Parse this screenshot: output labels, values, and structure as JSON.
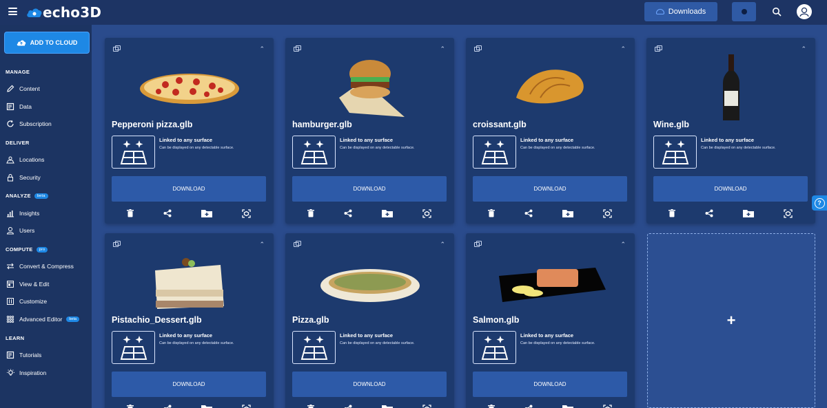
{
  "app": {
    "name": "echo3D"
  },
  "topbar": {
    "downloads_label": "Downloads"
  },
  "sidebar": {
    "add_button": "ADD TO CLOUD",
    "sections": {
      "manage": "MANAGE",
      "deliver": "DELIVER",
      "analyze": "ANALYZE",
      "analyze_badge": "beta",
      "compute": "COMPUTE",
      "compute_badge": "pro",
      "learn": "LEARN"
    },
    "items": {
      "content": "Content",
      "data": "Data",
      "subscription": "Subscription",
      "locations": "Locations",
      "security": "Security",
      "insights": "Insights",
      "users": "Users",
      "convert": "Convert & Compress",
      "view_edit": "View & Edit",
      "customize": "Customize",
      "advanced_editor": "Advanced Editor",
      "advanced_badge": "beta",
      "tutorials": "Tutorials",
      "inspiration": "Inspiration"
    }
  },
  "cards": [
    {
      "title": "Pepperoni pizza.glb",
      "thumb": "pepperoni-pizza"
    },
    {
      "title": "hamburger.glb",
      "thumb": "hamburger"
    },
    {
      "title": "croissant.glb",
      "thumb": "croissant"
    },
    {
      "title": "Wine.glb",
      "thumb": "wine-bottle"
    },
    {
      "title": "Pistachio_Dessert.glb",
      "thumb": "pistachio-dessert"
    },
    {
      "title": "Pizza.glb",
      "thumb": "pizza"
    },
    {
      "title": "Salmon.glb",
      "thumb": "salmon"
    }
  ],
  "card_common": {
    "linked_title": "Linked to any surface",
    "linked_sub": "Can be displayed on any detectable surface.",
    "download_label": "DOWNLOAD"
  },
  "add_card": {
    "label": "+"
  },
  "help": {
    "label": "?"
  }
}
